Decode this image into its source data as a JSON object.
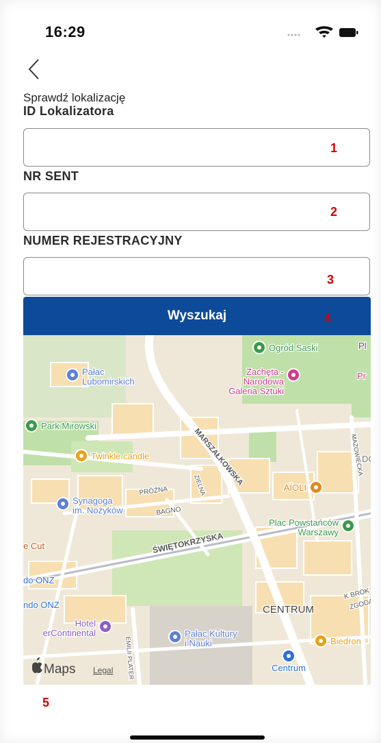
{
  "status_bar": {
    "time": "16:29"
  },
  "nav": {
    "back_icon": "chevron-left-icon"
  },
  "form": {
    "heading": "Sprawdź lokalizację",
    "locator_label": "ID Lokalizatora",
    "locator_value": "",
    "sent_label": "NR SENT",
    "sent_value": "",
    "plate_label": "NUMER REJESTRACYJNY",
    "plate_value": "",
    "search_button": "Wyszukaj"
  },
  "annotations": [
    "1",
    "2",
    "3",
    "4",
    "5"
  ],
  "map": {
    "streets": [
      "MARSZAŁKOWSKA",
      "PRÓŻNA",
      "ZIELNA",
      "BAGNO",
      "ŚWIĘTOKRZYSKA",
      "MAZOWIECKA",
      "EMILII PLATER",
      "ZGODA",
      "K BROK"
    ],
    "districts": [
      "CENTRUM"
    ],
    "pois": [
      {
        "name": "Ogród Saski",
        "lines": [
          "Ogród Saski"
        ],
        "color": "#3a9a4a"
      },
      {
        "name": "Pałac Lubomirskich",
        "lines": [
          "Pałac",
          "Lubomirskich"
        ],
        "color": "#5d7fd6"
      },
      {
        "name": "Zachęta - Narodowa Galeria Sztuki",
        "lines": [
          "Zachęta -",
          "Narodowa",
          "Galeria Sztuki"
        ],
        "color": "#d03c8a"
      },
      {
        "name": "Park Mirowski",
        "lines": [
          "Park Mirowski"
        ],
        "color": "#3a9a4a"
      },
      {
        "name": "Twinkle candle",
        "lines": [
          "Twinkle candle"
        ],
        "color": "#e8a21b"
      },
      {
        "name": "Synagoga im. Nożyków",
        "lines": [
          "Synagoga",
          "im. Nożyków"
        ],
        "color": "#5d7fd6"
      },
      {
        "name": "AÏOLI",
        "lines": [
          "AÏOLI"
        ],
        "color": "#e08a1e"
      },
      {
        "name": "Plac Powstańców Warszawy",
        "lines": [
          "Plac Powstańców",
          "Warszawy"
        ],
        "color": "#3a9a4a"
      },
      {
        "name": "Hotel InterContinental",
        "lines": [
          "Hotel",
          "erContinental"
        ],
        "color": "#8e5cc8"
      },
      {
        "name": "Pałac Kultury i Nauki",
        "lines": [
          "Pałac Kultury",
          "i Nauki"
        ],
        "color": "#5d7fd6"
      },
      {
        "name": "Biedronka",
        "lines": [
          "Biedron"
        ],
        "color": "#e8a21b"
      },
      {
        "name": "Centrum",
        "lines": [
          "Centrum"
        ],
        "color": "#2e6fd8"
      }
    ],
    "partial_labels": [
      "e Cut",
      "do ONZ",
      "ndo ONZ",
      "Pr",
      "Pl",
      "DO"
    ],
    "attribution": {
      "brand": "Maps",
      "legal": "Legal"
    }
  }
}
